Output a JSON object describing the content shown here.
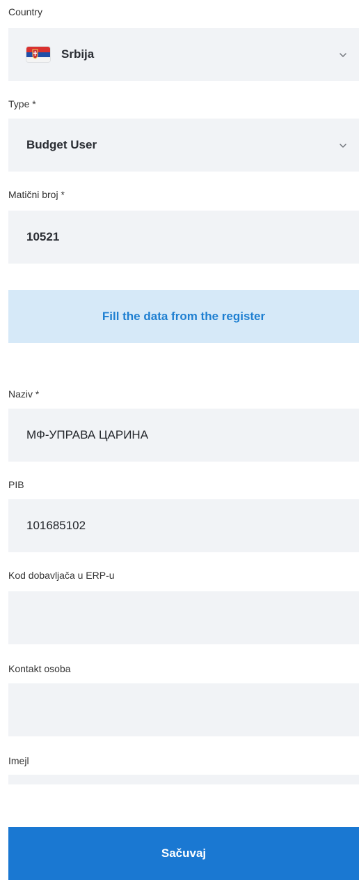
{
  "form": {
    "country": {
      "label": "Country",
      "value": "Srbija",
      "flag_icon": "serbia-flag-icon",
      "chevron_icon": "chevron-down-icon"
    },
    "type": {
      "label": "Type *",
      "value": "Budget User",
      "chevron_icon": "chevron-down-icon"
    },
    "maticni_broj": {
      "label": "Matični broj *",
      "value": "10521"
    },
    "register_button": {
      "label": "Fill the data from the register"
    },
    "naziv": {
      "label": "Naziv *",
      "value": "МФ-УПРАВА ЦАРИНА"
    },
    "pib": {
      "label": "PIB",
      "value": "101685102"
    },
    "kod_dobavljaca": {
      "label": "Kod dobavljača u ERP-u",
      "value": ""
    },
    "kontakt_osoba": {
      "label": "Kontakt osoba",
      "value": ""
    },
    "imejl": {
      "label": "Imejl",
      "value": ""
    },
    "save_button": {
      "label": "Sačuvaj"
    }
  },
  "colors": {
    "field_background": "#f1f3f6",
    "register_button_background": "#d6e9f8",
    "register_button_text": "#1e7fd1",
    "save_button_background": "#1a78d2",
    "save_button_text": "#ffffff"
  }
}
